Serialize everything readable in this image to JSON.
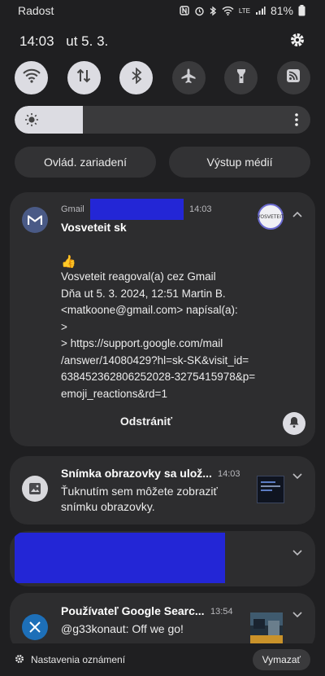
{
  "status_bar": {
    "carrier": "Radost",
    "network_type": "LTE",
    "battery": "81%"
  },
  "quick_settings": {
    "time": "14:03",
    "date": "ut 5. 3.",
    "tiles": [
      {
        "name": "wifi",
        "state": "on"
      },
      {
        "name": "mobile-data",
        "state": "on"
      },
      {
        "name": "bluetooth",
        "state": "on"
      },
      {
        "name": "airplane-mode",
        "state": "off"
      },
      {
        "name": "flashlight",
        "state": "off"
      },
      {
        "name": "feed",
        "state": "off"
      }
    ],
    "brightness_level": 0.23,
    "device_control_label": "Ovlád. zariadení",
    "media_output_label": "Výstup médií"
  },
  "notifications": {
    "gmail": {
      "app": "Gmail",
      "time": "14:03",
      "avatar_text": "VOSVETEIT",
      "title": "Vosveteit sk",
      "emoji": "👍",
      "lines": [
        "Vosveteit reagoval(a) cez Gmail",
        "Dňa ut 5. 3. 2024, 12:51 Martin B.",
        "<matkoone@gmail.com> napísal(a):",
        ">",
        "> https://support.google.com/mail",
        "/answer/14080429?hl=sk-SK&visit_id=",
        "638452362806252028-3275415978&p=",
        "emoji_reactions&rd=1"
      ],
      "action": "Odstrániť"
    },
    "screenshot": {
      "title": "Snímka obrazovky sa ulož...",
      "time": "14:03",
      "body_line1": "Ťuknutím sem môžete zobraziť",
      "body_line2": "snímku obrazovky."
    },
    "x": {
      "title": "Používateľ Google Searc...",
      "time": "13:54",
      "body": "@g33konaut: Off we go!"
    }
  },
  "footer": {
    "settings_label": "Nastavenia oznámení",
    "clear_label": "Vymazať"
  },
  "colors": {
    "background": "#1f1f21",
    "card": "#2d2d2f",
    "tile_on": "#dcdce2",
    "tile_off": "#3a3a3c",
    "redaction": "#2326d6"
  }
}
